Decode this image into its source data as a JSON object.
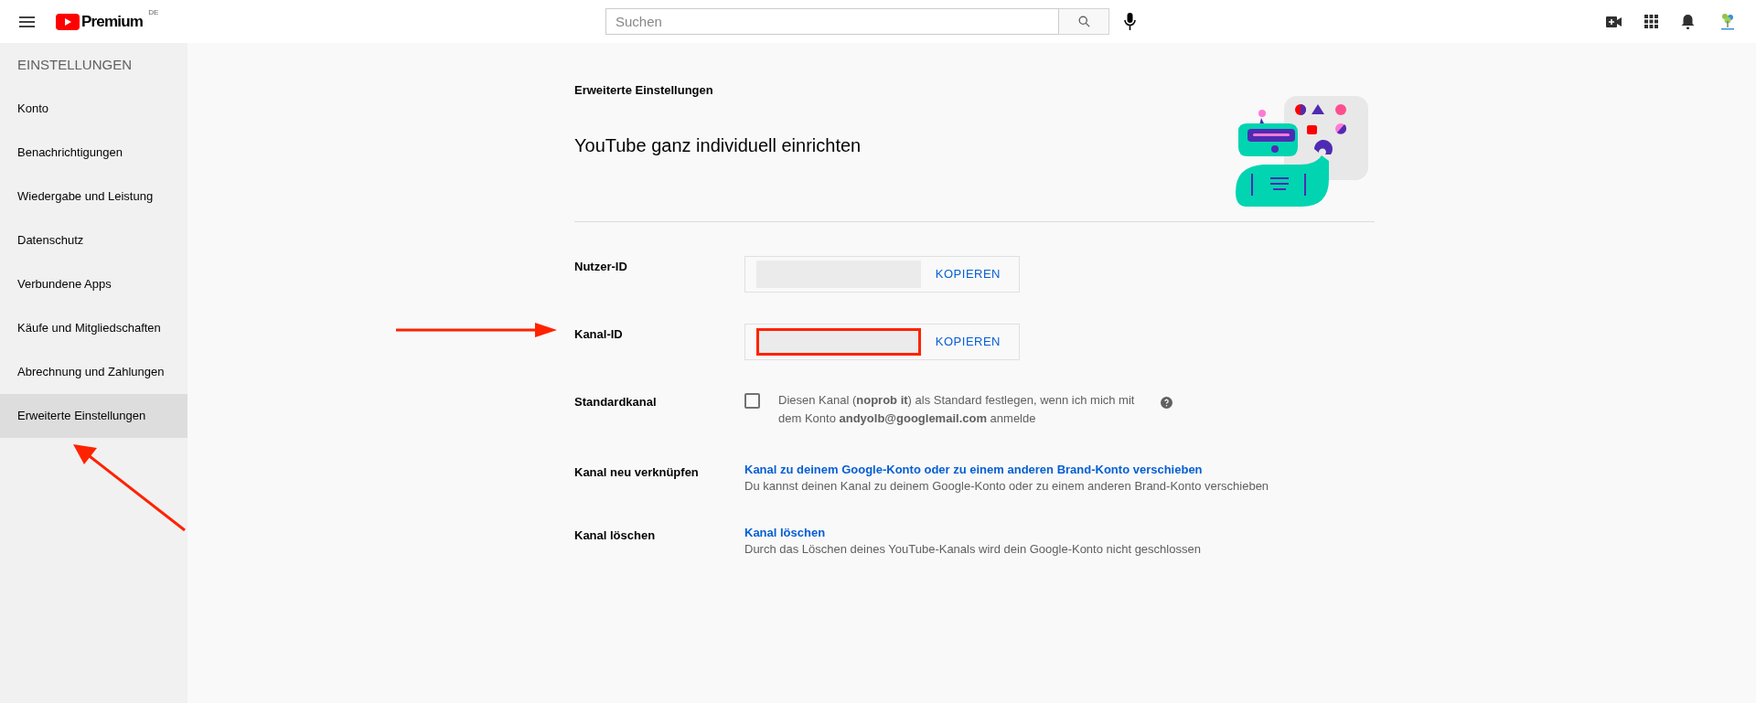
{
  "header": {
    "logo_text": "Premium",
    "region": "DE",
    "search": {
      "placeholder": "Suchen"
    }
  },
  "sidebar": {
    "title": "EINSTELLUNGEN",
    "items": [
      {
        "label": "Konto",
        "selected": false
      },
      {
        "label": "Benachrichtigungen",
        "selected": false
      },
      {
        "label": "Wiedergabe und Leistung",
        "selected": false
      },
      {
        "label": "Datenschutz",
        "selected": false
      },
      {
        "label": "Verbundene Apps",
        "selected": false
      },
      {
        "label": "Käufe und Mitgliedschaften",
        "selected": false
      },
      {
        "label": "Abrechnung und Zahlungen",
        "selected": false
      },
      {
        "label": "Erweiterte Einstellungen",
        "selected": true
      }
    ]
  },
  "content": {
    "section": "Erweiterte Einstellungen",
    "title": "YouTube ganz individuell einrichten",
    "rows": [
      {
        "kind": "id",
        "label": "Nutzer-ID",
        "button": "KOPIEREN",
        "highlighted": false
      },
      {
        "kind": "id",
        "label": "Kanal-ID",
        "button": "KOPIEREN",
        "highlighted": true
      },
      {
        "kind": "checkbox",
        "label": "Standardkanal",
        "checked": false,
        "text": "Diesen Kanal (**noprob it**) als Standard festlegen, wenn ich mich mit dem Konto **andyolb@googlemail.com** anmelde"
      },
      {
        "kind": "link",
        "label": "Kanal neu verknüpfen",
        "link": "Kanal zu deinem Google-Konto oder zu einem anderen Brand-Konto verschieben",
        "text": "Du kannst deinen Kanal zu deinem Google-Konto oder zu einem anderen Brand-Konto verschieben"
      },
      {
        "kind": "link",
        "label": "Kanal löschen",
        "link": "Kanal löschen",
        "text": "Durch das Löschen deines YouTube-Kanals wird dein Google-Konto nicht geschlossen"
      }
    ]
  }
}
